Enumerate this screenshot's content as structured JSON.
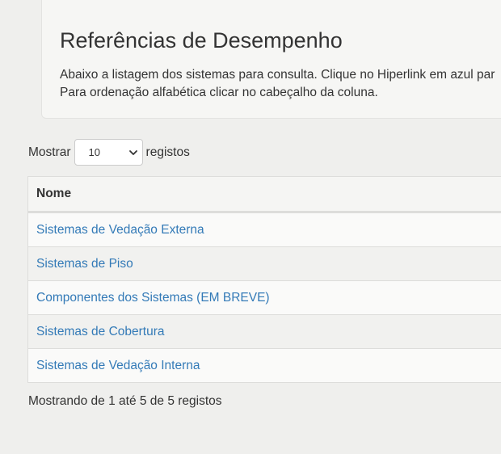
{
  "header": {
    "title": "Referências de Desempenho",
    "description_line1": "Abaixo a listagem dos sistemas para consulta. Clique no Hiperlink em azul par",
    "description_line2": "Para ordenação alfabética clicar no cabeçalho da coluna."
  },
  "length_control": {
    "prefix": "Mostrar",
    "selected": "10",
    "suffix": "registos"
  },
  "table": {
    "column_header": "Nome",
    "rows": [
      "Sistemas de Vedação Externa",
      "Sistemas de Piso",
      "Componentes dos Sistemas (EM BREVE)",
      "Sistemas de Cobertura",
      "Sistemas de Vedação Interna"
    ]
  },
  "info": "Mostrando de 1 até 5 de 5 registos",
  "colors": {
    "link": "#337ab7",
    "background": "#efefed"
  }
}
